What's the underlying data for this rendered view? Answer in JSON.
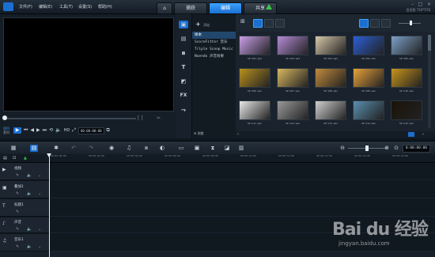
{
  "menu": [
    "文件(F)",
    "编辑(E)",
    "工具(T)",
    "设置(S)",
    "帮助(H)"
  ],
  "tabs": [
    {
      "label": "⌂"
    },
    {
      "label": "捕获"
    },
    {
      "label": "编辑"
    },
    {
      "label": "共享"
    }
  ],
  "user_info": "会员版  720*576",
  "preview": {
    "project_label": "项目",
    "clip_label": "素材",
    "hd_label": "HD",
    "timecode": "00:00:00:00"
  },
  "library": {
    "add_label": "添加",
    "folders": [
      "样本",
      "ScoreFitter 音乐",
      "Triple Scoop Music",
      "Nuendo 声音效果"
    ],
    "browse_label": "浏览",
    "thumbnails": [
      {
        "label": "SP-V01.mp4",
        "color": "#c9a0e8"
      },
      {
        "label": "SP-V02.mp4",
        "color": "#b58bd6"
      },
      {
        "label": "SP-V03.mp4",
        "color": "#d6c7a8"
      },
      {
        "label": "SP-V04.wmv",
        "color": "#2c5fd6"
      },
      {
        "label": "SP-V05.wmv",
        "color": "#7ca0c8"
      },
      {
        "label": "SP-V06.wmv",
        "color": "#b8901e"
      },
      {
        "label": "SP-V07.wmv",
        "color": "#d9b860"
      },
      {
        "label": "SP-V08.wmv",
        "color": "#c08a3c"
      },
      {
        "label": "SP-V09.wmv",
        "color": "#e7a23a"
      },
      {
        "label": "SP-V10.wmv",
        "color": "#c7941c"
      },
      {
        "label": "SP-V11.wmv",
        "color": "#e8e8e8"
      },
      {
        "label": "SP-V12.wmv",
        "color": "#9a9a9a"
      },
      {
        "label": "SP-V13.wmv",
        "color": "#d0d0d0"
      },
      {
        "label": "SP-V14.wmv",
        "color": "#5a8fb0"
      },
      {
        "label": "SP-V15.wmv",
        "color": "#1a1208"
      }
    ]
  },
  "timeline": {
    "timecode": "0:00:00:00",
    "ruler": [
      "00:00:00:00",
      "00:00:02:00",
      "00:00:04:00",
      "00:00:06:00",
      "00:00:08:00",
      "00:00:10:00",
      "00:00:12:00",
      "00:00:14:00",
      "00:00:16:00",
      "00:00:18:00"
    ],
    "tracks": [
      "视频",
      "叠加1",
      "标题1",
      "声音",
      "音乐1"
    ]
  },
  "watermark": {
    "main": "Bai du 经验",
    "sub": "jingyan.baidu.com"
  }
}
